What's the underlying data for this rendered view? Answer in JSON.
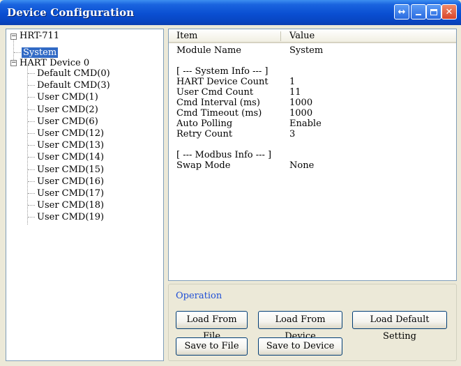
{
  "window": {
    "title": "Device Configuration"
  },
  "titlebar_buttons": {
    "restore_symbol": "↔",
    "close_symbol": "✕"
  },
  "tree": {
    "root": "HRT-711",
    "system": "System",
    "device": "HART Device 0",
    "commands": [
      "Default CMD(0)",
      "Default CMD(3)",
      "User CMD(1)",
      "User CMD(2)",
      "User CMD(6)",
      "User CMD(12)",
      "User CMD(13)",
      "User CMD(14)",
      "User CMD(15)",
      "User CMD(16)",
      "User CMD(17)",
      "User CMD(18)",
      "User CMD(19)"
    ]
  },
  "table": {
    "headers": {
      "item": "Item",
      "value": "Value"
    },
    "rows": [
      {
        "item": "Module Name",
        "value": "System"
      },
      {
        "item": "",
        "value": ""
      },
      {
        "item": "[ --- System Info --- ]",
        "value": ""
      },
      {
        "item": "HART Device Count",
        "value": "1"
      },
      {
        "item": "User Cmd Count",
        "value": "11"
      },
      {
        "item": "Cmd Interval (ms)",
        "value": "1000"
      },
      {
        "item": "Cmd Timeout (ms)",
        "value": "1000"
      },
      {
        "item": "Auto Polling",
        "value": "Enable"
      },
      {
        "item": "Retry Count",
        "value": "3"
      },
      {
        "item": "",
        "value": ""
      },
      {
        "item": "[ --- Modbus Info --- ]",
        "value": ""
      },
      {
        "item": "Swap Mode",
        "value": "None"
      }
    ]
  },
  "operation": {
    "label": "Operation",
    "load_from_file": "Load From File",
    "load_from_device": "Load From Device",
    "load_default": "Load Default Setting",
    "save_to_file": "Save to File",
    "save_to_device": "Save to Device"
  }
}
